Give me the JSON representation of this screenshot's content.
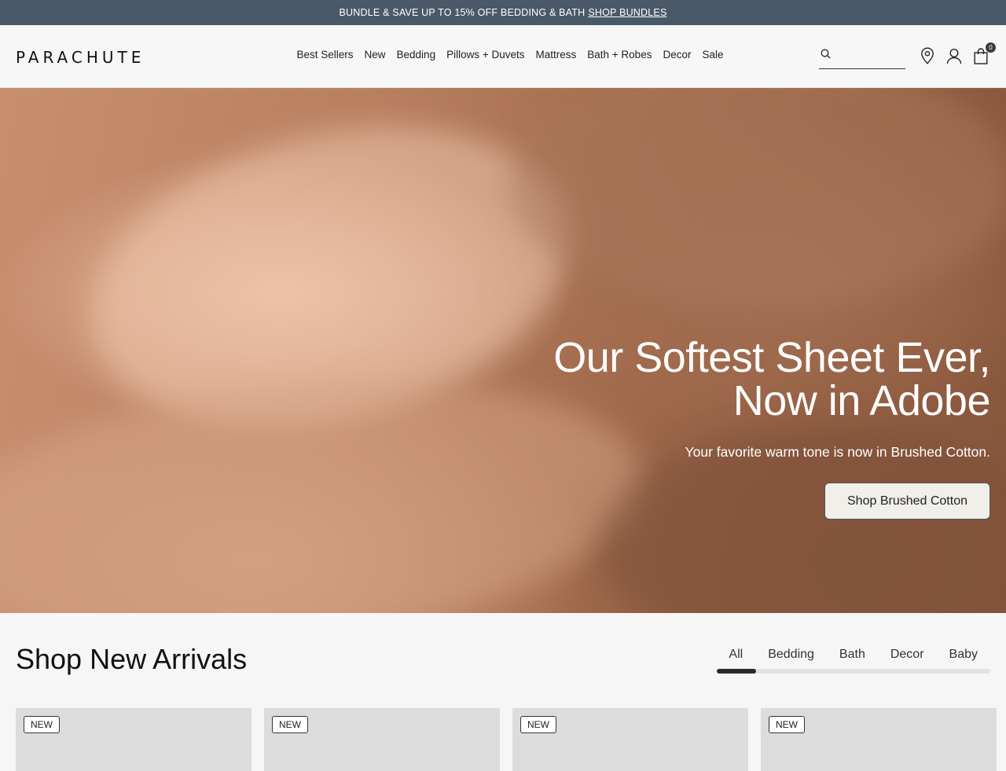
{
  "promo": {
    "text": "BUNDLE & SAVE UP TO 15% OFF BEDDING & BATH",
    "link": "SHOP BUNDLES"
  },
  "header": {
    "logo": "PARACHUTE",
    "nav": [
      "Best Sellers",
      "New",
      "Bedding",
      "Pillows + Duvets",
      "Mattress",
      "Bath + Robes",
      "Decor",
      "Sale"
    ],
    "search_placeholder": "",
    "cart_count": "0",
    "icons": [
      "search-icon",
      "location-pin-icon",
      "account-icon",
      "shopping-bag-icon"
    ]
  },
  "hero": {
    "title_line1": "Our Softest Sheet Ever,",
    "title_line2": "Now in Adobe",
    "subtitle": "Your favorite warm tone is now in Brushed Cotton.",
    "cta": "Shop Brushed Cotton"
  },
  "arrivals": {
    "title": "Shop New Arrivals",
    "tabs": [
      "All",
      "Bedding",
      "Bath",
      "Decor",
      "Baby"
    ],
    "active_tab": "All"
  },
  "products": [
    {
      "badge": "NEW"
    },
    {
      "badge": "NEW"
    },
    {
      "badge": "NEW"
    },
    {
      "badge": "NEW"
    }
  ],
  "colors": {
    "promo_bg": "#49596a",
    "hero_tone": "#b87f5f",
    "accent": "#2a2a2a"
  }
}
